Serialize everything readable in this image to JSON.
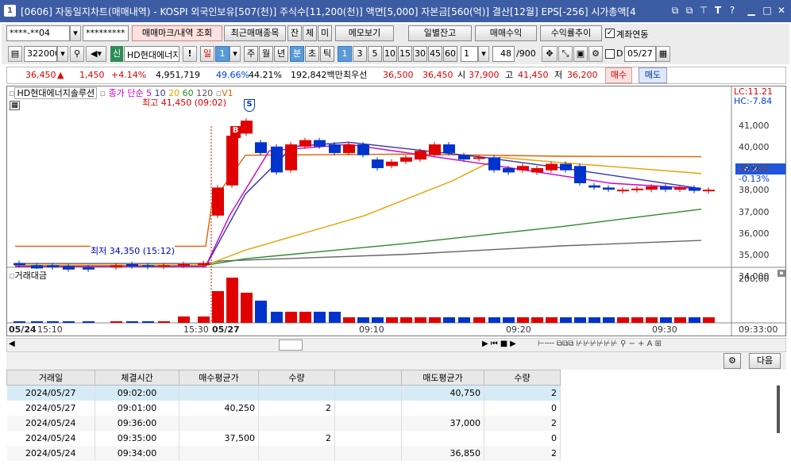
{
  "window": {
    "number": "1",
    "title": "[0606] 자동일지차트(매매내역) - KOSPI 외국인보유[507(천)] 주식수[11,200(천)] 액면[5,000] 자본금[560(억)] 결산[12월] EPS[-256] 시가총액[4"
  },
  "toolbar1": {
    "account": "****-**04",
    "password": "*********",
    "btn_mark": "매매마크/내역 조회",
    "btn_recent": "최근매매종목",
    "btn_jan": "잔",
    "btn_che": "체",
    "btn_mi": "미",
    "btn_memo": "메모보기",
    "btn_daily": "일별잔고",
    "btn_profit": "매매수익",
    "btn_rate": "수익률추이",
    "chk_account": "계좌연동"
  },
  "toolbar2": {
    "code": "322000",
    "shin": "신",
    "stock_name": "HD현대에너지",
    "excl": "!",
    "il": "일",
    "il_num": "1",
    "ju": "주",
    "wol": "월",
    "nyeon": "년",
    "bun": "분",
    "cho": "초",
    "tik": "틱",
    "intervals": [
      "1",
      "3",
      "5",
      "10",
      "15",
      "30",
      "45",
      "60"
    ],
    "sel_interval": "1",
    "count": "48",
    "count_total": "/900",
    "d_label": "D",
    "date": "05/27"
  },
  "quote": {
    "price": "36,450",
    "up": "▲",
    "change": "1,450",
    "rate": "+4.14%",
    "volume": "4,951,719",
    "vol_rate": "49.66%",
    "vol_rate2": "44.21%",
    "amount": "192,842백만",
    "best_ask_label": "최우선",
    "best_ask": "36,500",
    "best_bid": "36,450",
    "open_label": "시",
    "open": "37,900",
    "high_label": "고",
    "high": "41,450",
    "low_label": "저",
    "low": "36,200",
    "buy_btn": "매수",
    "sell_btn": "매도"
  },
  "chart": {
    "stock_label": "HD현대에너지솔루션",
    "ma_label": "종가 단순",
    "ma_5": "5",
    "ma_10": "10",
    "ma_20": "20",
    "ma_60": "60",
    "ma_120": "120",
    "v1": "V1",
    "high_note": "최고 41,450 (09:02)",
    "low_note": "최저 34,350 (15:12)",
    "lc": "LC:11.21",
    "hc": "HC:-7.84",
    "cur_price": "38,200",
    "cur_rate": "-0.13%",
    "marker_b": "B",
    "marker_s": "S",
    "vol_label": "거래대금",
    "vol_axis": "200,00",
    "price_ticks": [
      "41,000",
      "40,000",
      "39,000",
      "38,000",
      "37,000",
      "36,000",
      "35,000",
      "34,000"
    ],
    "time_labels": [
      "05/24",
      "15:10",
      "15:30",
      "05/27",
      "09:10",
      "09:20",
      "09:30",
      "09:33:00"
    ]
  },
  "chart_data": {
    "type": "candlestick",
    "x": [
      "05/24 15:10",
      "05/24 15:30",
      "05/27 09:00",
      "05/27 09:10",
      "05/27 09:20",
      "05/27 09:30"
    ],
    "current": 38200,
    "high": 41450,
    "low": 34350
  },
  "bottom": {
    "settings_icon": "gear-icon",
    "next_btn": "다음",
    "headers": [
      "거래일",
      "체결시간",
      "매수평균가",
      "수량",
      "",
      "매도평균가",
      "수량"
    ],
    "rows": [
      [
        "2024/05/27",
        "09:02:00",
        "",
        "",
        "",
        "40,750",
        "2"
      ],
      [
        "2024/05/27",
        "09:01:00",
        "40,250",
        "2",
        "",
        "",
        "0"
      ],
      [
        "2024/05/24",
        "09:36:00",
        "",
        "",
        "",
        "37,000",
        "2"
      ],
      [
        "2024/05/24",
        "09:35:00",
        "37,500",
        "2",
        "",
        "",
        "0"
      ],
      [
        "2024/05/24",
        "09:34:00",
        "",
        "",
        "",
        "36,850",
        "2"
      ]
    ]
  }
}
